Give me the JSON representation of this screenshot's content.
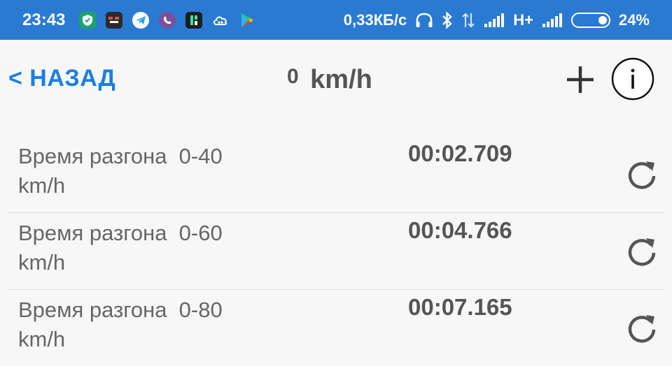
{
  "status_bar": {
    "time": "23:43",
    "net_speed": "0,33КБ/с",
    "network_type": "H+",
    "battery": "24%",
    "battery_level_percent": 24,
    "app_icons": [
      "shield-icon",
      "game-icon",
      "telegram-icon",
      "viber-icon",
      "taxi-icon",
      "cloud-icon",
      "play-store-icon"
    ]
  },
  "nav": {
    "back_label": "< НАЗАД",
    "speed_value": "0",
    "speed_unit": "km/h"
  },
  "rows": [
    {
      "label": "Время разгона  0-40 km/h",
      "time": "00:02.709"
    },
    {
      "label": "Время разгона  0-60 km/h",
      "time": "00:04.766"
    },
    {
      "label": "Время разгона  0-80 km/h",
      "time": "00:07.165"
    }
  ],
  "colors": {
    "status_bar": "#2a7ad2",
    "accent": "#1a7ee6",
    "background": "#f7f7f7",
    "text_gray": "#555555"
  }
}
